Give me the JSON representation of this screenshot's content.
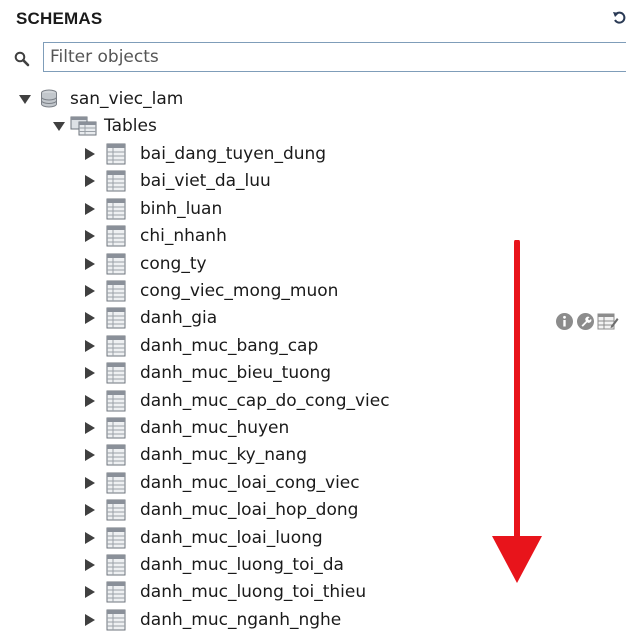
{
  "panel": {
    "title": "SCHEMAS"
  },
  "filter": {
    "placeholder": "Filter objects",
    "value": ""
  },
  "tree": {
    "schema": {
      "name": "san_viec_lam",
      "expanded": true,
      "icon": "database-icon"
    },
    "tables_folder": {
      "label": "Tables",
      "expanded": true,
      "icon": "tables-folder-icon"
    },
    "tables": [
      "bai_dang_tuyen_dung",
      "bai_viet_da_luu",
      "binh_luan",
      "chi_nhanh",
      "cong_ty",
      "cong_viec_mong_muon",
      "danh_gia",
      "danh_muc_bang_cap",
      "danh_muc_bieu_tuong",
      "danh_muc_cap_do_cong_viec",
      "danh_muc_huyen",
      "danh_muc_ky_nang",
      "danh_muc_loai_cong_viec",
      "danh_muc_loai_hop_dong",
      "danh_muc_loai_luong",
      "danh_muc_luong_toi_da",
      "danh_muc_luong_toi_thieu",
      "danh_muc_nganh_nghe"
    ],
    "hovered_row": "danh_gia",
    "hover_actions": [
      "info-icon",
      "settings-wrench-icon",
      "table-data-icon"
    ]
  },
  "colors": {
    "arrow": "#e8141b",
    "toggle": "#404040",
    "input_border": "#7f9db9"
  }
}
